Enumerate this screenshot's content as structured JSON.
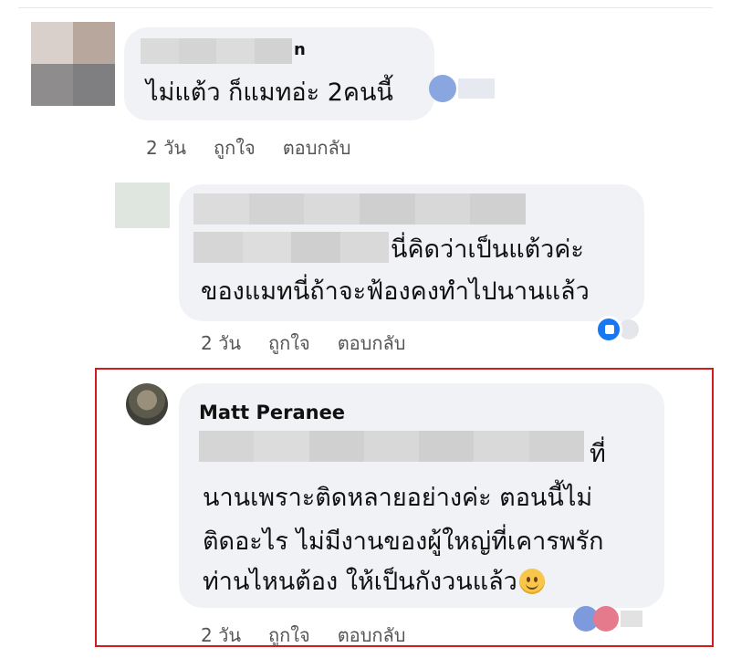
{
  "comments": [
    {
      "text_lines": [
        "ไม่แต้ว ก็แมทอ่ะ 2คนนี้"
      ],
      "name_suffix": "n",
      "time": "2 วัน",
      "like_label": "ถูกใจ",
      "reply_label": "ตอบกลับ"
    },
    {
      "text_lines": [
        "นี่คิดว่าเป็นแต้วค่ะ",
        "ของแมทนี่ถ้าจะฟ้องคงทำไปนานแล้ว"
      ],
      "time": "2 วัน",
      "like_label": "ถูกใจ",
      "reply_label": "ตอบกลับ"
    },
    {
      "author": "Matt Peranee",
      "text_lines": [
        "ที่",
        "นานเพราะติดหลายอย่างค่ะ ตอนนี้ไม่",
        "ติดอะไร ไม่มีงานของผู้ใหญ่ที่เคารพรัก",
        "ท่านไหนต้อง ให้เป็นกังวนแล้ว"
      ],
      "emoji": "smiling-face",
      "time": "2 วัน",
      "like_label": "ถูกใจ",
      "reply_label": "ตอบกลับ",
      "highlighted": true,
      "highlight_color": "#d01c1c"
    }
  ],
  "colors": {
    "bubble": "#f0f2f5",
    "like_blue": "#1877f2",
    "love_red": "#e4405f"
  }
}
